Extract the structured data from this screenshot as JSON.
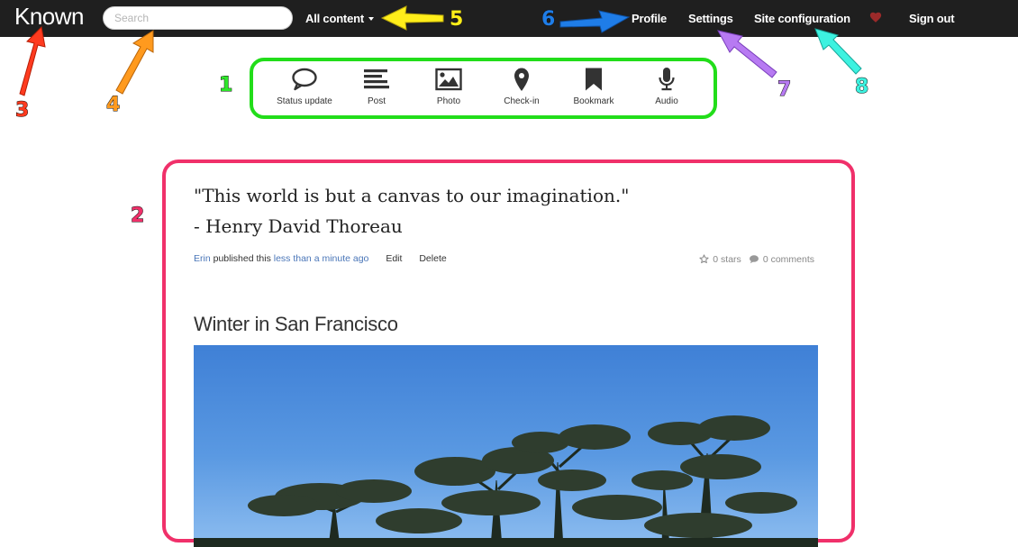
{
  "navbar": {
    "brand": "Known",
    "search_placeholder": "Search",
    "filter_label": "All content",
    "profile": "Profile",
    "settings": "Settings",
    "site_configuration": "Site configuration",
    "sign_out": "Sign out"
  },
  "toolbar": {
    "items": [
      {
        "label": "Status update",
        "icon": "speech-bubble-icon"
      },
      {
        "label": "Post",
        "icon": "text-lines-icon"
      },
      {
        "label": "Photo",
        "icon": "image-icon"
      },
      {
        "label": "Check-in",
        "icon": "map-pin-icon"
      },
      {
        "label": "Bookmark",
        "icon": "bookmark-icon"
      },
      {
        "label": "Audio",
        "icon": "microphone-icon"
      }
    ]
  },
  "feed": {
    "status": {
      "quote_line1": "\"This world is but a canvas to our imagination.\"",
      "quote_line2": "- Henry David Thoreau",
      "author": "Erin",
      "published_text": "published this",
      "time": "less than a minute ago",
      "edit": "Edit",
      "delete": "Delete",
      "stars": "0 stars",
      "comments": "0 comments"
    },
    "photo_post": {
      "title": "Winter in San Francisco"
    }
  },
  "annotations": {
    "n1": "1",
    "n2": "2",
    "n3": "3",
    "n4": "4",
    "n5": "5",
    "n6": "6",
    "n7": "7",
    "n8": "8"
  },
  "colors": {
    "navbar_bg": "#1f1f1f",
    "toolbar_highlight": "#22dd1a",
    "feed_highlight": "#f0306a",
    "link": "#4a76b8",
    "heart": "#9b2a2a"
  }
}
